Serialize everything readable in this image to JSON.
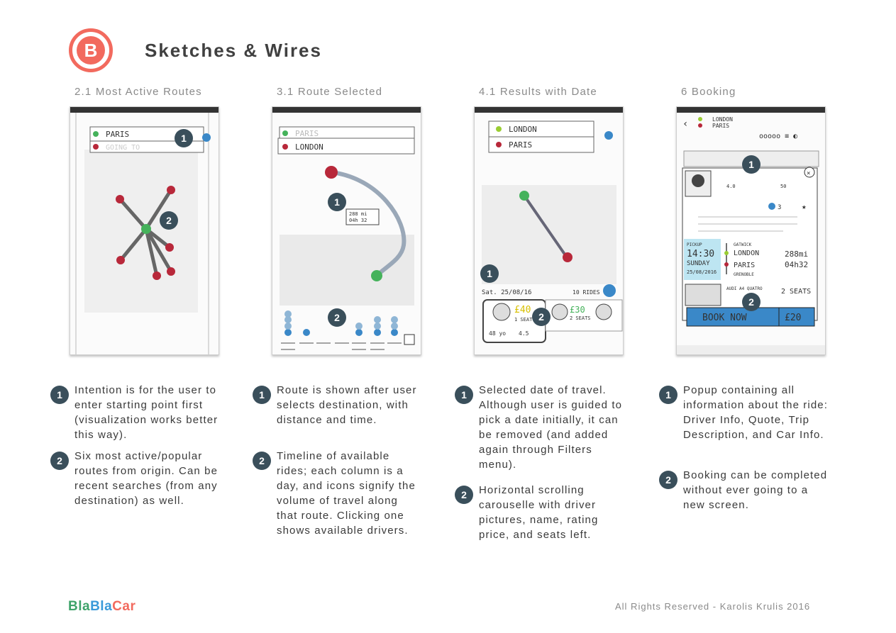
{
  "header": {
    "logo_letter": "B",
    "title": "Sketches & Wires",
    "accent_color": "#f26a5e"
  },
  "columns": [
    {
      "title": "2.1 Most Active Routes",
      "sketch": {
        "field1": "PARIS",
        "field2": "GOING TO"
      },
      "notes": [
        {
          "num": "1",
          "text": "Intention is for the user to enter starting point first (visualization works better this way)."
        },
        {
          "num": "2",
          "text": "Six most active/popular routes from origin. Can be recent searches (from any destination) as well."
        }
      ]
    },
    {
      "title": "3.1 Route Selected",
      "sketch": {
        "field1": "PARIS",
        "field2": "LONDON",
        "distance": "288 mi",
        "time": "04h 32"
      },
      "notes": [
        {
          "num": "1",
          "text": "Route is shown after user selects destination, with distance and time."
        },
        {
          "num": "2",
          "text": "Timeline of available rides; each column is a day, and icons signify the volume of travel along that route. Clicking one shows available drivers."
        }
      ]
    },
    {
      "title": "4.1 Results with Date",
      "sketch": {
        "field1": "LONDON",
        "field2": "PARIS",
        "date": "Sat. 25/08/16",
        "rides": "10 RIDES",
        "price1": "£40",
        "price2": "£30",
        "seats1": "1 SEAT",
        "seats2": "2 SEATS",
        "rating": "4.5",
        "age": "48 yo"
      },
      "notes": [
        {
          "num": "1",
          "text": "Selected date of travel. Although user is guided to pick a date initially, it can be removed (and added again through Filters menu)."
        },
        {
          "num": "2",
          "text": "Horizontal scrolling carouselle with driver pictures, name, rating price, and seats left."
        }
      ]
    },
    {
      "title": "6 Booking",
      "sketch": {
        "from": "LONDON",
        "to": "PARIS",
        "pickup_label": "PICKUP",
        "pickup_time": "14:30",
        "pickup_day": "SUNDAY",
        "pickup_date": "25/08/2016",
        "stop1": "GATWICK",
        "stop2": "LONDON",
        "stop3": "PARIS",
        "stop4": "GRENOBLE",
        "distance": "288mi",
        "time": "04h32",
        "car": "AUDI A4 QUATRO",
        "seats": "2 SEATS",
        "book": "BOOK NOW",
        "price": "£20",
        "rating": "4.0",
        "count": "50",
        "questions": "3"
      },
      "notes": [
        {
          "num": "1",
          "text": "Popup containing all information about the ride: Driver Info, Quote, Trip Description, and Car Info."
        },
        {
          "num": "2",
          "text": "Booking can be completed without ever going to a new screen."
        }
      ]
    }
  ],
  "footer": {
    "brand_part1": "Bla",
    "brand_part2": "Bla",
    "brand_part3": "Car",
    "copyright": "All Rights Reserved - Karolis Krulis 2016"
  }
}
